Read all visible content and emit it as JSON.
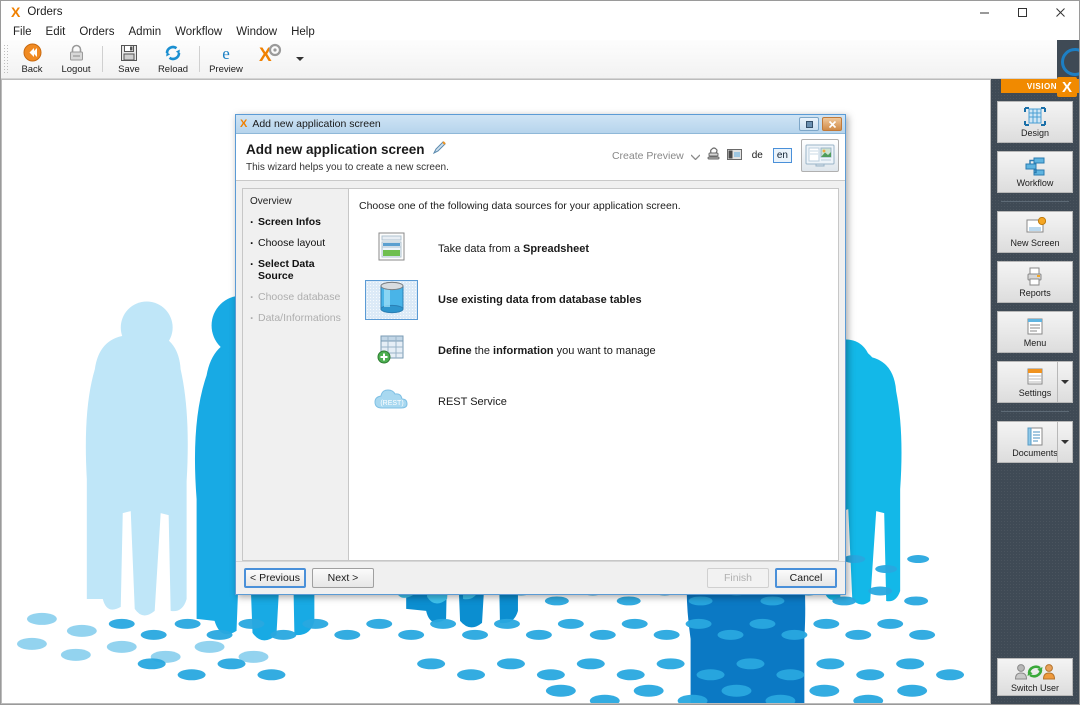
{
  "window": {
    "app_initial": "X",
    "title": "Orders",
    "controls": [
      {
        "name": "minimize",
        "glyph": "minimize-icon"
      },
      {
        "name": "maximize",
        "glyph": "maximize-icon"
      },
      {
        "name": "close",
        "glyph": "close-icon"
      }
    ]
  },
  "menubar": {
    "items": [
      "File",
      "Edit",
      "Orders",
      "Admin",
      "Workflow",
      "Window",
      "Help"
    ]
  },
  "toolbar": {
    "buttons": [
      {
        "label": "Back",
        "icon": "back-arrow-icon"
      },
      {
        "label": "Logout",
        "icon": "padlock-icon"
      },
      {
        "label": "Save",
        "icon": "floppy-disk-icon"
      },
      {
        "label": "Reload",
        "icon": "refresh-arrows-icon"
      },
      {
        "label": "Preview",
        "icon": "edge-browser-icon"
      }
    ],
    "vision_button_icon": "vision-x-gear-icon",
    "overflow_icon": "chevron-down-icon"
  },
  "sidebar": {
    "banner_text": "VISION",
    "banner_logo": "X",
    "banner_color": "#f18a00",
    "items": [
      {
        "label": "Design",
        "icon": "design-grid-icon",
        "has_dropdown": false
      },
      {
        "label": "Workflow",
        "icon": "workflow-flowchart-icon",
        "has_dropdown": false
      },
      {
        "label": "New Screen",
        "icon": "new-screen-icon",
        "has_dropdown": false
      },
      {
        "label": "Reports",
        "icon": "reports-printer-icon",
        "has_dropdown": false
      },
      {
        "label": "Menu",
        "icon": "menu-list-icon",
        "has_dropdown": false
      },
      {
        "label": "Settings",
        "icon": "settings-table-icon",
        "has_dropdown": true
      },
      {
        "label": "Documents",
        "icon": "documents-notebook-icon",
        "has_dropdown": true
      }
    ],
    "switch_user": {
      "label": "Switch User",
      "icon": "switch-user-icon"
    }
  },
  "dialog": {
    "titlebar": {
      "logo": "X",
      "title": "Add new application screen",
      "buttons": [
        {
          "name": "restore",
          "glyph": "restore-icon"
        },
        {
          "name": "close",
          "glyph": "close-icon"
        }
      ]
    },
    "heading": "Add new application screen",
    "heading_icon": "pencil-edit-icon",
    "subheading": "This wizard helps you to create a new screen.",
    "header_tools": {
      "create_preview_label": "Create Preview",
      "create_preview_caret": "chevron-down-icon",
      "stamp_icon": "stamp-icon",
      "card_icon": "id-card-icon",
      "lang_de": "de",
      "lang_en": "en",
      "active_lang": "en",
      "thumbnail_icon": "screen-preview-thumbnail-icon"
    },
    "nav": {
      "title": "Overview",
      "items": [
        {
          "label": "Screen Infos",
          "state": "done"
        },
        {
          "label": "Choose layout",
          "state": "done"
        },
        {
          "label": "Select Data Source",
          "state": "current"
        },
        {
          "label": "Choose database",
          "state": "disabled"
        },
        {
          "label": "Data/Informations",
          "state": "disabled"
        }
      ]
    },
    "content": {
      "intro": "Choose one of the following data sources for your application screen.",
      "options": [
        {
          "id": "spreadsheet",
          "icon": "spreadsheet-icon",
          "text_parts": [
            {
              "t": "Take data from a ",
              "bold": false
            },
            {
              "t": "Spreadsheet",
              "bold": true
            }
          ],
          "selected": false
        },
        {
          "id": "database-tables",
          "icon": "database-cylinder-icon",
          "text_parts": [
            {
              "t": "Use existing data from database tables",
              "bold": true
            }
          ],
          "selected": true
        },
        {
          "id": "define-information",
          "icon": "new-table-plus-icon",
          "text_parts": [
            {
              "t": "Define",
              "bold": true
            },
            {
              "t": " the ",
              "bold": false
            },
            {
              "t": "information",
              "bold": true
            },
            {
              "t": " you want to manage",
              "bold": false
            }
          ],
          "selected": false
        },
        {
          "id": "rest-service",
          "icon": "rest-cloud-icon",
          "text_parts": [
            {
              "t": "REST Service",
              "bold": false
            }
          ],
          "selected": false
        }
      ]
    },
    "footer": {
      "previous": "< Previous",
      "next": "Next >",
      "finish": "Finish",
      "finish_disabled": true,
      "cancel": "Cancel"
    }
  },
  "colors": {
    "brand_orange": "#f08000",
    "accent_blue": "#4a90d9",
    "sidebar_dark": "#3f4a55",
    "silhouette_blue": "#1ea7e1",
    "silhouette_light": "#9bd9f2",
    "silhouette_dark": "#0b79c4"
  }
}
